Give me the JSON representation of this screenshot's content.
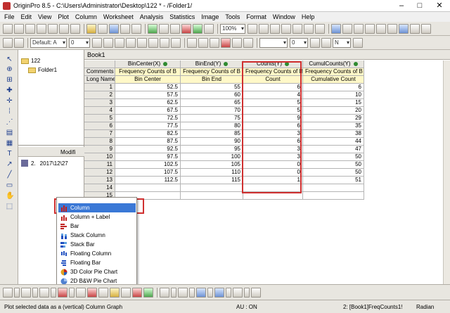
{
  "window": {
    "title": "OriginPro 8.5 - C:\\Users\\Administrator\\Desktop\\122 * - /Folder1/"
  },
  "menu": [
    "File",
    "Edit",
    "View",
    "Plot",
    "Column",
    "Worksheet",
    "Analysis",
    "Statistics",
    "Image",
    "Tools",
    "Format",
    "Window",
    "Help"
  ],
  "toolbar": {
    "zoom": "100%",
    "font": "Default: A",
    "font_size": "0",
    "line_width": "0",
    "col_count": "N"
  },
  "explorer": {
    "root": "122",
    "child": "Folder1",
    "list_header": "Modifi",
    "list_row_index": "2.",
    "list_row_date": "2017\\12\\27"
  },
  "book": {
    "title": "Book1",
    "row_labels": {
      "comments": "Comments",
      "long_name": "Long Name"
    },
    "columns": [
      {
        "header": "BinCenter(X)",
        "comment": "Frequency Counts of B",
        "long_name": "Bin Center"
      },
      {
        "header": "BinEnd(Y)",
        "comment": "Frequency Counts of B",
        "long_name": "Bin End"
      },
      {
        "header": "Counts(Y)",
        "comment": "Frequency Counts of B",
        "long_name": "Count"
      },
      {
        "header": "CumulCounts(Y)",
        "comment": "Frequency Counts of B",
        "long_name": "Cumulative Count"
      }
    ],
    "rows": [
      [
        "1",
        "52.5",
        "55",
        "6",
        "6"
      ],
      [
        "2",
        "57.5",
        "60",
        "4",
        "10"
      ],
      [
        "3",
        "62.5",
        "65",
        "5",
        "15"
      ],
      [
        "4",
        "67.5",
        "70",
        "5",
        "20"
      ],
      [
        "5",
        "72.5",
        "75",
        "9",
        "29"
      ],
      [
        "6",
        "77.5",
        "80",
        "6",
        "35"
      ],
      [
        "7",
        "82.5",
        "85",
        "3",
        "38"
      ],
      [
        "8",
        "87.5",
        "90",
        "6",
        "44"
      ],
      [
        "9",
        "92.5",
        "95",
        "3",
        "47"
      ],
      [
        "10",
        "97.5",
        "100",
        "3",
        "50"
      ],
      [
        "11",
        "102.5",
        "105",
        "0",
        "50"
      ],
      [
        "12",
        "107.5",
        "110",
        "0",
        "50"
      ],
      [
        "13",
        "112.5",
        "115",
        "1",
        "51"
      ],
      [
        "14",
        "",
        "",
        "",
        ""
      ],
      [
        "15",
        "",
        "",
        "",
        ""
      ]
    ]
  },
  "popup_menu": [
    "Column",
    "Column + Label",
    "Bar",
    "Stack Column",
    "Stack Bar",
    "Floating Column",
    "Floating Bar",
    "3D Color Pie Chart",
    "2D B&W Pie Chart"
  ],
  "status": {
    "message": "Plot selected data as a (vertical) Column Graph",
    "au": "AU : ON",
    "sheet": "2: [Book1]FreqCounts1!",
    "angle": "Radian"
  }
}
